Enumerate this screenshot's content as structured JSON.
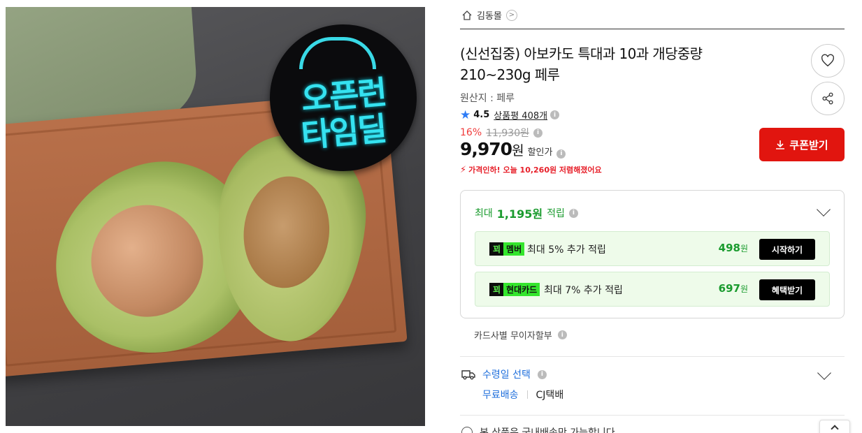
{
  "breadcrumb": {
    "store_name": "김동몰"
  },
  "product": {
    "title": "(신선집중) 아보카도 특대과 10과 개당중량 210~230g 페루",
    "origin": "원산지 : 페루",
    "rating": "4.5",
    "reviews": "상품평 408개",
    "badge_line1": "오픈런",
    "badge_line2": "타임딜"
  },
  "price": {
    "discount": "16%",
    "original": "11,930원",
    "current": "9,970",
    "currency": "원",
    "label": "할인가",
    "drop_notice": "가격인하! 오늘 10,260원 저렴해졌어요"
  },
  "coupon": {
    "label": "쿠폰받기"
  },
  "points": {
    "prefix": "최대",
    "amount": "1,195원",
    "suffix": "적립",
    "offers": [
      {
        "tag_k": "꾀",
        "tag_name": "멤버",
        "text": "최대 5% 추가 적립",
        "amount": "498",
        "unit": "원",
        "action": "시작하기"
      },
      {
        "tag_k": "꾀",
        "tag_name": "현대카드",
        "text": "최대 7% 추가 적립",
        "amount": "697",
        "unit": "원",
        "action": "혜택받기"
      }
    ]
  },
  "installment": "카드사별 무이자할부",
  "delivery": {
    "title": "수령일 선택",
    "free": "무료배송",
    "carrier": "CJ택배"
  },
  "overseas_notice": "본 상품은 국내배송만 가능합니다.",
  "colors": {
    "accent_red": "#e1150f",
    "green": "#1a9b2e",
    "blue": "#1f6fdc",
    "star": "#2e7cf6"
  }
}
